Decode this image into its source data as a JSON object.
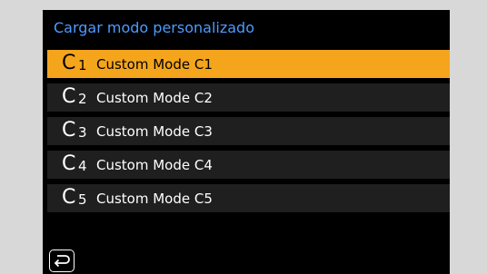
{
  "menu": {
    "title": "Cargar modo personalizado",
    "items": [
      {
        "letter": "C",
        "number": "1",
        "label": "Custom Mode C1",
        "selected": true
      },
      {
        "letter": "C",
        "number": "2",
        "label": "Custom Mode C2",
        "selected": false
      },
      {
        "letter": "C",
        "number": "3",
        "label": "Custom Mode C3",
        "selected": false
      },
      {
        "letter": "C",
        "number": "4",
        "label": "Custom Mode C4",
        "selected": false
      },
      {
        "letter": "C",
        "number": "5",
        "label": "Custom Mode C5",
        "selected": false
      }
    ]
  },
  "colors": {
    "title": "#4d9bff",
    "selected_row": "#f5a51c",
    "row": "#1f1f1f",
    "screen": "#000000",
    "frame": "#d8d8d8"
  },
  "icons": {
    "back": "return-arrow-icon"
  }
}
